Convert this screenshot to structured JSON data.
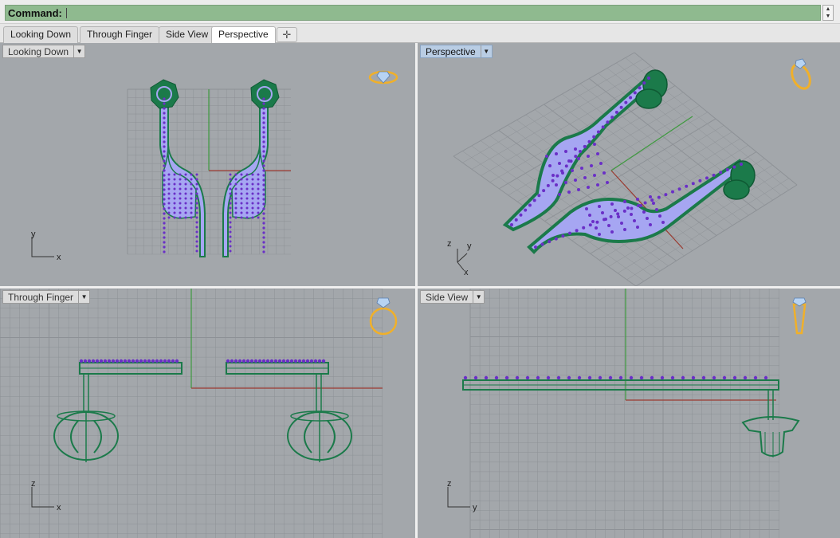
{
  "command_bar": {
    "label": "Command:",
    "value": ""
  },
  "tabs": [
    {
      "label": "Looking Down",
      "active": false
    },
    {
      "label": "Through Finger",
      "active": false
    },
    {
      "label": "Side View",
      "active": false
    },
    {
      "label": "Perspective",
      "active": true
    }
  ],
  "add_tab_icon": "plus-icon",
  "viewports": {
    "top_left": {
      "title": "Looking Down",
      "axis_a": "y",
      "axis_b": "x",
      "active": false
    },
    "top_right": {
      "title": "Perspective",
      "axis_a": "z",
      "axis_b": "y",
      "axis_c": "x",
      "active": true
    },
    "bottom_left": {
      "title": "Through Finger",
      "axis_a": "z",
      "axis_b": "x",
      "active": false
    },
    "bottom_right": {
      "title": "Side View",
      "axis_a": "z",
      "axis_b": "y",
      "active": false
    }
  },
  "colors": {
    "command_field": "#8fba8f",
    "viewport_bg": "#a3a7ab",
    "model_green": "#1b7a4a",
    "gem_fill": "#a6a6f2",
    "gem_dot": "#6a2fc7",
    "axis_x": "#9a3a30",
    "axis_y": "#3f9a3f",
    "ring_icon": "#f0b02a"
  }
}
